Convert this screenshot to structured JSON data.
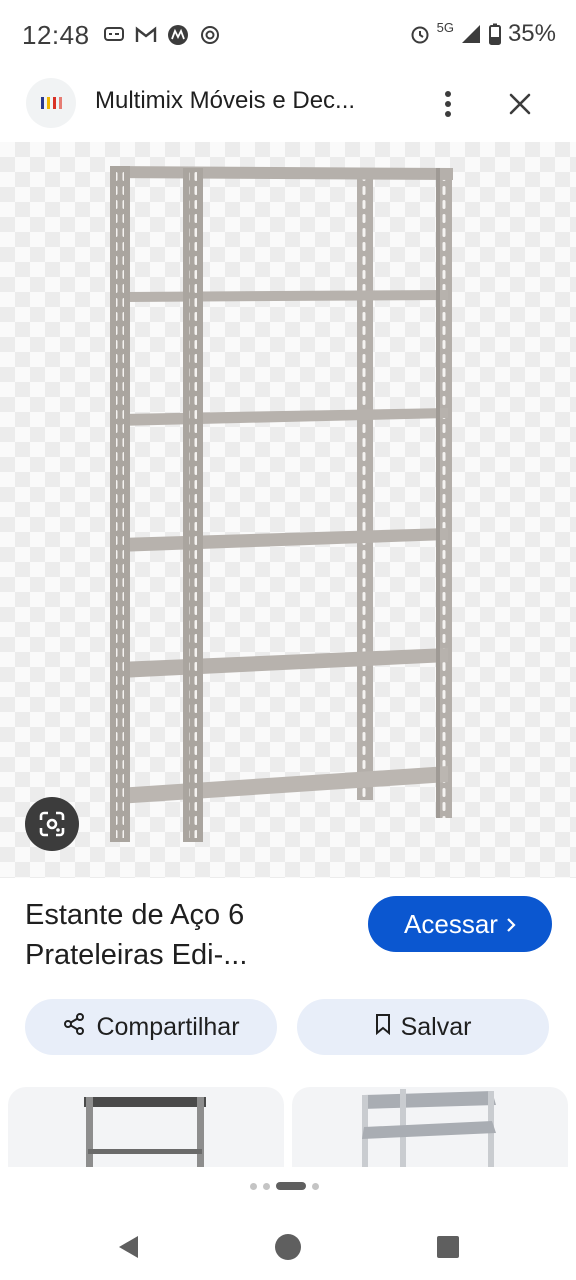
{
  "status_bar": {
    "time": "12:48",
    "signal": "5G",
    "battery": "35%",
    "icons": [
      "message-icon",
      "gmail-icon",
      "motorola-icon",
      "openai-icon",
      "alarm-icon",
      "signal-icon",
      "battery-icon"
    ]
  },
  "top_bar": {
    "site_title": "Multimix Móveis e Dec...",
    "icons": [
      "site-favicon",
      "more-vert-icon",
      "close-icon"
    ]
  },
  "image": {
    "subject": "steel-shelf-6-tier",
    "lens_icon": "google-lens-icon"
  },
  "product": {
    "title_line1": "Estante de Aço 6",
    "title_line2": "Prateleiras Edi-...",
    "visit_label": "Acessar",
    "visit_icon": "chevron-right-icon"
  },
  "actions": {
    "share_label": "Compartilhar",
    "save_label": "Salvar"
  },
  "pagination": {
    "active_index": 2,
    "count": 4
  },
  "colors": {
    "accent": "#0b57d0",
    "pill_bg": "#e8eef9",
    "shelf": "#b7b2ad"
  },
  "nav_bar": {
    "icons": [
      "back-icon",
      "home-icon",
      "recents-icon"
    ]
  }
}
